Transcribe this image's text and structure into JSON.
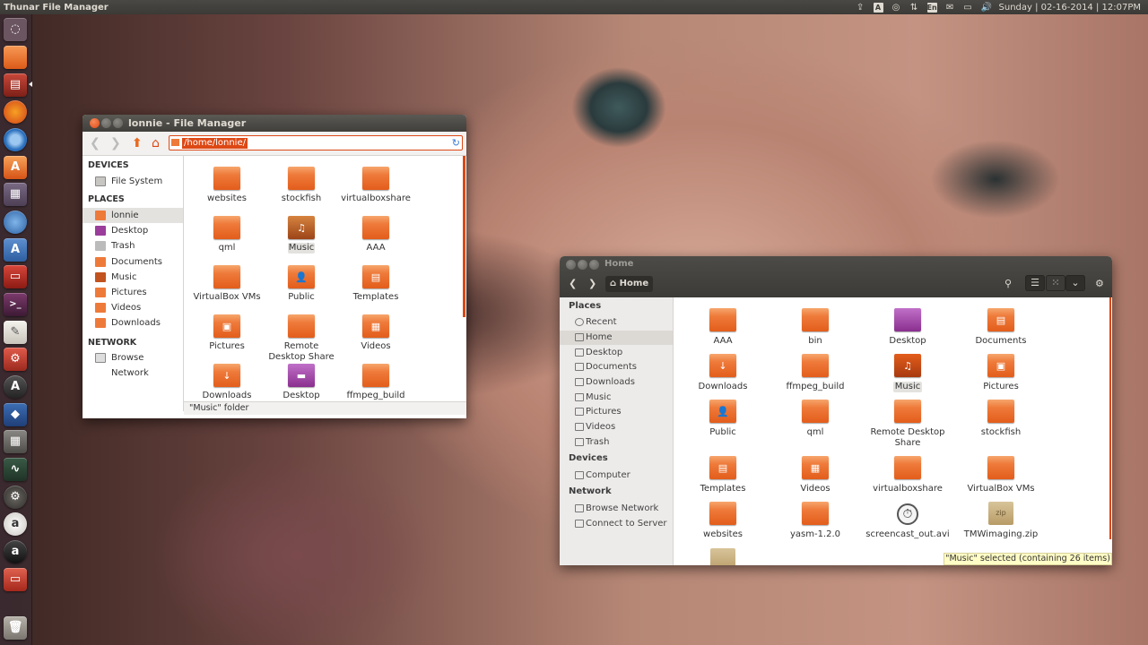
{
  "panel": {
    "app_title": "Thunar File Manager",
    "clock": "Sunday | 02-16-2014 | 12:07PM",
    "tray_icons": [
      "upload-icon",
      "accessibility-a-icon",
      "settings-wheel-icon",
      "network-arrows-icon",
      "keyboard-en-icon",
      "mail-icon",
      "battery-icon",
      "volume-icon"
    ],
    "tray_texts": {
      "a": "A",
      "en": "En"
    }
  },
  "launcher": {
    "items": [
      "dash-home",
      "files",
      "image-viewer",
      "firefox",
      "chromium",
      "software-center",
      "workspaces",
      "update-manager",
      "text-editor-a",
      "presentation",
      "terminal",
      "notes",
      "system-settings",
      "ubuntu-one",
      "security-shield",
      "calculator",
      "system-monitor",
      "gear-settings",
      "font-viewer",
      "amazon",
      "removable-drive",
      "trash"
    ],
    "labels": {
      "software-center": "A",
      "text-editor-a": "A",
      "amazon": "a"
    }
  },
  "thunar": {
    "title": "lonnie - File Manager",
    "path": "/home/lonnie/",
    "sidebar": {
      "devices_header": "DEVICES",
      "devices": [
        {
          "label": "File System",
          "icon": "drive-icon"
        }
      ],
      "places_header": "PLACES",
      "places": [
        {
          "label": "lonnie",
          "icon": "home-folder-icon"
        },
        {
          "label": "Desktop",
          "icon": "desktop-icon"
        },
        {
          "label": "Trash",
          "icon": "trash-icon"
        },
        {
          "label": "Documents",
          "icon": "folder-icon"
        },
        {
          "label": "Music",
          "icon": "music-folder-icon"
        },
        {
          "label": "Pictures",
          "icon": "pictures-folder-icon"
        },
        {
          "label": "Videos",
          "icon": "videos-folder-icon"
        },
        {
          "label": "Downloads",
          "icon": "downloads-folder-icon"
        }
      ],
      "network_header": "NETWORK",
      "network": [
        {
          "label": "Browse Network",
          "icon": "network-icon"
        }
      ]
    },
    "files": [
      {
        "label": "websites",
        "emblem": ""
      },
      {
        "label": "stockfish",
        "emblem": ""
      },
      {
        "label": "virtualboxshare",
        "emblem": ""
      },
      {
        "label": "qml",
        "emblem": ""
      },
      {
        "label": "Music",
        "emblem": "♫"
      },
      {
        "label": "AAA",
        "emblem": ""
      },
      {
        "label": "VirtualBox VMs",
        "emblem": ""
      },
      {
        "label": "Public",
        "emblem": "👤"
      },
      {
        "label": "Templates",
        "emblem": "▤"
      },
      {
        "label": "Pictures",
        "emblem": "▣"
      },
      {
        "label": "Remote\nDesktop Share",
        "emblem": ""
      },
      {
        "label": "Videos",
        "emblem": "▦"
      },
      {
        "label": "Downloads",
        "emblem": "↓"
      },
      {
        "label": "Desktop",
        "emblem": "▬"
      },
      {
        "label": "ffmpeg_build",
        "emblem": ""
      }
    ],
    "status": "\"Music\" folder"
  },
  "nautilus": {
    "title": "Home",
    "path_button": "Home",
    "sidebar": {
      "places_header": "Places",
      "places": [
        {
          "label": "Recent",
          "icon": "clock-icon"
        },
        {
          "label": "Home",
          "icon": "home-icon"
        },
        {
          "label": "Desktop",
          "icon": "desktop-icon"
        },
        {
          "label": "Documents",
          "icon": "documents-icon"
        },
        {
          "label": "Downloads",
          "icon": "downloads-icon"
        },
        {
          "label": "Music",
          "icon": "music-icon"
        },
        {
          "label": "Pictures",
          "icon": "pictures-icon"
        },
        {
          "label": "Videos",
          "icon": "videos-icon"
        },
        {
          "label": "Trash",
          "icon": "trash-icon"
        }
      ],
      "devices_header": "Devices",
      "devices": [
        {
          "label": "Computer",
          "icon": "computer-icon"
        }
      ],
      "network_header": "Network",
      "network": [
        {
          "label": "Browse Network",
          "icon": "network-icon"
        },
        {
          "label": "Connect to Server",
          "icon": "server-icon"
        }
      ]
    },
    "files": [
      {
        "label": "AAA",
        "kind": "folder",
        "emblem": ""
      },
      {
        "label": "bin",
        "kind": "folder",
        "emblem": ""
      },
      {
        "label": "Desktop",
        "kind": "desktop",
        "emblem": ""
      },
      {
        "label": "Documents",
        "kind": "folder",
        "emblem": "▤"
      },
      {
        "label": "Downloads",
        "kind": "folder",
        "emblem": "↓"
      },
      {
        "label": "ffmpeg_build",
        "kind": "folder",
        "emblem": ""
      },
      {
        "label": "Music",
        "kind": "music",
        "emblem": "♫"
      },
      {
        "label": "Pictures",
        "kind": "folder",
        "emblem": "▣"
      },
      {
        "label": "Public",
        "kind": "folder",
        "emblem": "👤"
      },
      {
        "label": "qml",
        "kind": "folder",
        "emblem": ""
      },
      {
        "label": "Remote Desktop\nShare",
        "kind": "folder",
        "emblem": ""
      },
      {
        "label": "stockfish",
        "kind": "folder",
        "emblem": ""
      },
      {
        "label": "Templates",
        "kind": "folder",
        "emblem": "▤"
      },
      {
        "label": "Videos",
        "kind": "folder",
        "emblem": "▦"
      },
      {
        "label": "virtualboxshare",
        "kind": "folder",
        "emblem": ""
      },
      {
        "label": "VirtualBox VMs",
        "kind": "folder",
        "emblem": ""
      },
      {
        "label": "websites",
        "kind": "folder",
        "emblem": ""
      },
      {
        "label": "yasm-1.2.0",
        "kind": "folder",
        "emblem": ""
      },
      {
        "label": "screencast_out.avi",
        "kind": "video",
        "emblem": ""
      },
      {
        "label": "TMWimaging.zip",
        "kind": "zip",
        "emblem": "zip"
      },
      {
        "label": "",
        "kind": "archive",
        "emblem": ""
      }
    ],
    "status": "\"Music\" selected  (containing 26 items)"
  },
  "colors": {
    "accent": "#dd4814",
    "folder": "#ee7a3a",
    "panel": "#3c3b37",
    "desktop_folder": "#9b3d9b",
    "selection": "#e3e2df"
  }
}
